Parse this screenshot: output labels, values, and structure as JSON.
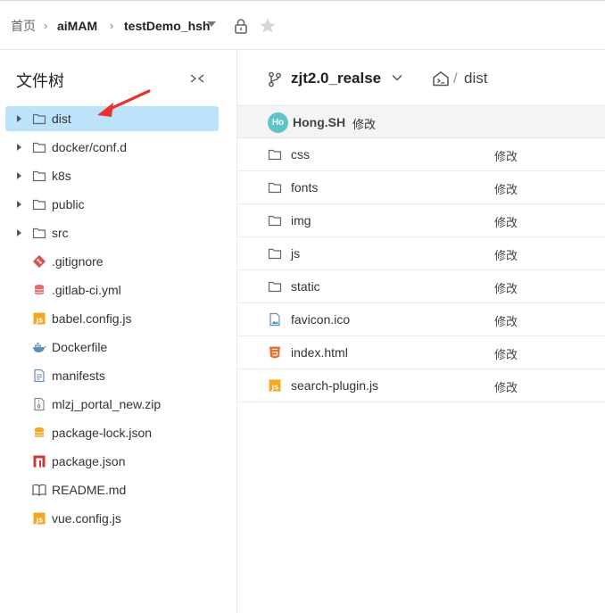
{
  "breadcrumb": {
    "home": "首页",
    "repo": "aiMAM",
    "project": "testDemo_hsh"
  },
  "sidebar": {
    "title": "文件树",
    "items": [
      {
        "label": "dist",
        "type": "folder",
        "expandable": true,
        "active": true
      },
      {
        "label": "docker/conf.d",
        "type": "folder",
        "expandable": true
      },
      {
        "label": "k8s",
        "type": "folder",
        "expandable": true
      },
      {
        "label": "public",
        "type": "folder",
        "expandable": true
      },
      {
        "label": "src",
        "type": "folder",
        "expandable": true
      },
      {
        "label": ".gitignore",
        "type": "git-icon"
      },
      {
        "label": ".gitlab-ci.yml",
        "type": "yaml-icon"
      },
      {
        "label": "babel.config.js",
        "type": "js-icon"
      },
      {
        "label": "Dockerfile",
        "type": "docker-icon"
      },
      {
        "label": "manifests",
        "type": "text-file-icon"
      },
      {
        "label": "mlzj_portal_new.zip",
        "type": "zip-icon"
      },
      {
        "label": "package-lock.json",
        "type": "json-icon"
      },
      {
        "label": "package.json",
        "type": "npm-icon"
      },
      {
        "label": "README.md",
        "type": "book-icon"
      },
      {
        "label": "vue.config.js",
        "type": "js-icon"
      }
    ]
  },
  "main": {
    "branch": "zjt2.0_realse",
    "path_sep": "/",
    "path": "dist",
    "commit": {
      "avatar_initials": "Ho",
      "author": "Hong.SH",
      "message": "修改"
    },
    "files": [
      {
        "name": "css",
        "type": "folder",
        "message": "修改"
      },
      {
        "name": "fonts",
        "type": "folder",
        "message": "修改"
      },
      {
        "name": "img",
        "type": "folder",
        "message": "修改"
      },
      {
        "name": "js",
        "type": "folder",
        "message": "修改"
      },
      {
        "name": "static",
        "type": "folder",
        "message": "修改"
      },
      {
        "name": "favicon.ico",
        "type": "image-icon",
        "message": "修改"
      },
      {
        "name": "index.html",
        "type": "html5-icon",
        "message": "修改"
      },
      {
        "name": "search-plugin.js",
        "type": "js-icon",
        "message": "修改"
      }
    ]
  },
  "colors": {
    "active_row": "#bde3fb",
    "annotation_arrow": "#e8322e",
    "avatar_bg": "#5fc3c8"
  }
}
